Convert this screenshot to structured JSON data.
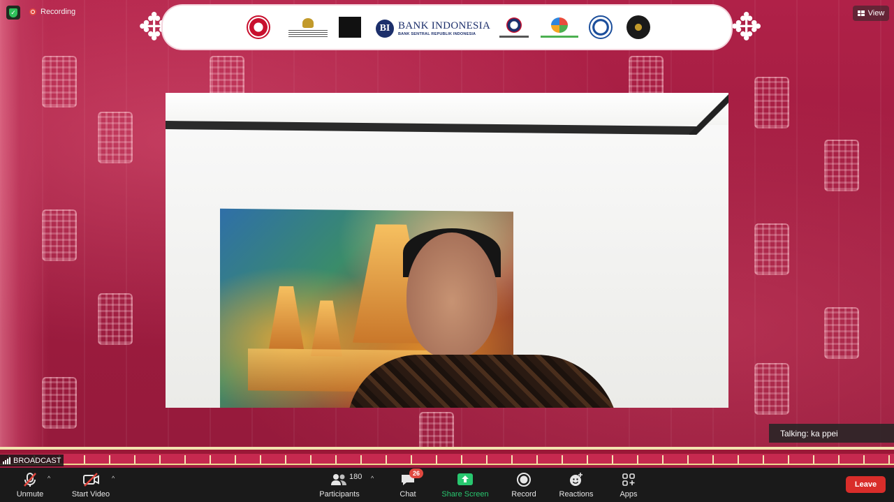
{
  "status": {
    "recording_label": "Recording",
    "view_label": "View"
  },
  "banner": {
    "bank_name": "BANK INDONESIA",
    "bank_subtitle": "BANK SENTRAL REPUBLIK INDONESIA",
    "logos": [
      "indonesia-logo-1",
      "garuda-emblem-icon",
      "black-square-logo",
      "bank-indonesia-logo",
      "ministry-logo",
      "kemenperin-logo",
      "circle-emblem-logo",
      "dark-seal-logo"
    ]
  },
  "video": {
    "talking_label": "Talking: ka ppei",
    "broadcast_label": "BROADCAST"
  },
  "toolbar": {
    "unmute": "Unmute",
    "start_video": "Start Video",
    "participants": "Participants",
    "participants_count": "180",
    "chat": "Chat",
    "chat_badge": "26",
    "share_screen": "Share Screen",
    "record": "Record",
    "reactions": "Reactions",
    "apps": "Apps",
    "leave": "Leave"
  },
  "colors": {
    "accent_share": "#28c76f",
    "leave_red": "#d92d2a",
    "badge_red": "#e0483f"
  }
}
